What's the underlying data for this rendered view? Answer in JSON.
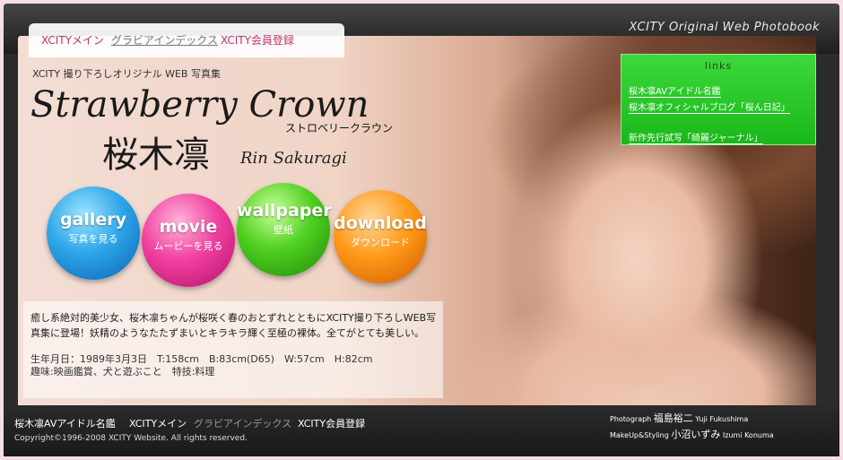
{
  "header": {
    "brand": "XCITY Original Web Photobook"
  },
  "tabs": [
    {
      "label": "XCITYメイン"
    },
    {
      "label": "グラビアインデックス"
    },
    {
      "label": "XCITY会員登録"
    }
  ],
  "hero": {
    "subtitle": "XCITY 撮り下ろしオリジナル WEB 写真集",
    "title": "Strawberry Crown",
    "title_kana": "ストロベリークラウン",
    "name_jp": "桜木凛",
    "name_en": "Rin Sakuragi"
  },
  "menu": [
    {
      "label": "gallery",
      "sub": "写真を見る"
    },
    {
      "label": "movie",
      "sub": "ムービーを見る"
    },
    {
      "label": "wallpaper",
      "sub": "壁紙"
    },
    {
      "label": "download",
      "sub": "ダウンロード"
    }
  ],
  "links": {
    "heading": "links",
    "items": [
      "桜木凛AVアイドル名鑑",
      "桜木凛オフィシャルブログ「桜ん日記」",
      "新作先行試写「綺麗ジャーナル」"
    ]
  },
  "description": {
    "intro": "癒し系絶対的美少女、桜木凛ちゃんが桜咲く春のおとずれとともにXCITY撮り下ろしWEB写真集に登場！妖精のようなたたずまいとキラキラ輝く至極の裸体。全てがとても美しい。",
    "profile_line1": "生年月日：1989年3月3日　T:158cm　B:83cm(D65)　W:57cm　H:82cm",
    "profile_line2": "趣味:映画鑑賞、犬と遊ぶこと　特技:料理"
  },
  "credits": {
    "photo_label": "Photograph",
    "photo_name": "福島裕二",
    "photo_en": "Yuji Fukushima",
    "makeup_label": "MakeUp&Styling",
    "makeup_name": "小沼いずみ",
    "makeup_en": "Izumi Konuma"
  },
  "footer": {
    "links": [
      "桜木凛AVアイドル名鑑",
      "XCITYメイン",
      "グラビアインデックス",
      "XCITY会員登録"
    ],
    "copyright": "Copyright©1996-2008 XCITY Website. All rights reserved."
  },
  "colors": {
    "accent": "#c0306a",
    "links_bg": "#2fcf2f",
    "frame": "#2b2b2b"
  }
}
